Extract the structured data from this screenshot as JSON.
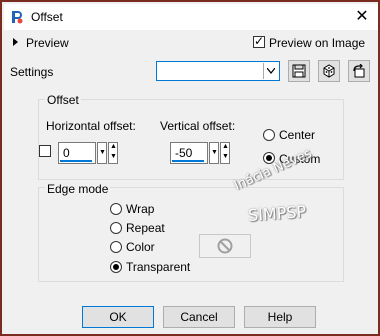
{
  "window": {
    "title": "Offset"
  },
  "icons": {
    "app": "paintshop-pro-icon",
    "close": "close-icon"
  },
  "preview": {
    "label": "Preview",
    "preview_on_image_label": "Preview on Image",
    "preview_on_image_checked": true
  },
  "settings": {
    "label": "Settings",
    "preset_value": ""
  },
  "offset": {
    "group_label": "Offset",
    "horizontal_label": "Horizontal offset:",
    "horizontal_value": "0",
    "vertical_label": "Vertical offset:",
    "vertical_value": "-50",
    "origin_options": [
      {
        "label": "Center",
        "selected": false
      },
      {
        "label": "Custom",
        "selected": true
      }
    ]
  },
  "edge_mode": {
    "group_label": "Edge mode",
    "options": [
      {
        "label": "Wrap",
        "selected": false
      },
      {
        "label": "Repeat",
        "selected": false
      },
      {
        "label": "Color",
        "selected": false
      },
      {
        "label": "Transparent",
        "selected": true
      }
    ]
  },
  "watermark": {
    "line1": "Inácia Neves",
    "line2": "SIMPSP"
  },
  "buttons": {
    "ok": "OK",
    "cancel": "Cancel",
    "help": "Help"
  }
}
